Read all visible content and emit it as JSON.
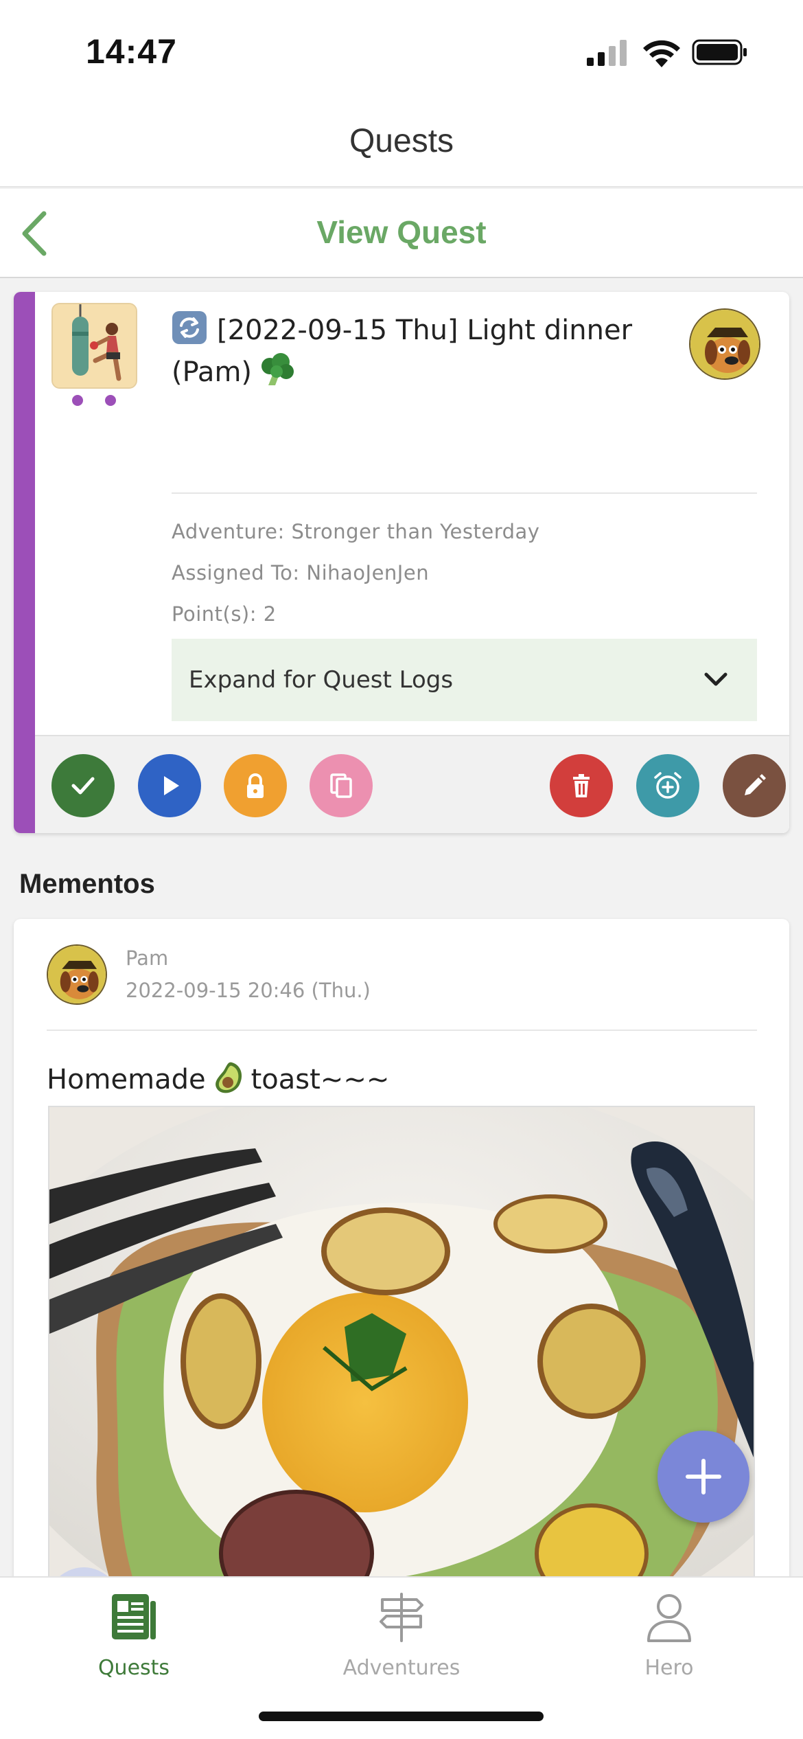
{
  "status_bar": {
    "time": "14:47"
  },
  "header": {
    "title": "Quests"
  },
  "sub_header": {
    "title": "View Quest"
  },
  "quest": {
    "title": "[2022-09-15 Thu] Light dinner (Pam)",
    "adventure": "Adventure: Stronger than Yesterday",
    "assigned_to": "Assigned To: NihaoJenJen",
    "points": "Point(s): 2",
    "expand_label": "Expand for Quest Logs",
    "stripe_color": "#9c4fb8",
    "icons": {
      "repeat": "repeat-icon",
      "broccoli": "broccoli-emoji-icon",
      "thumbnail": "boxing-workout-illustration",
      "avatar": "dog-hat-avatar-icon",
      "chevron": "chevron-down-icon"
    },
    "actions": [
      {
        "name": "complete",
        "icon": "check-icon",
        "color": "#3d7a3a"
      },
      {
        "name": "start",
        "icon": "play-icon",
        "color": "#2f63c5"
      },
      {
        "name": "lock",
        "icon": "lock-icon",
        "color": "#f0a030"
      },
      {
        "name": "duplicate",
        "icon": "copy-icon",
        "color": "#ec90b0"
      },
      {
        "name": "delete",
        "icon": "trash-icon",
        "color": "#d23e3c"
      },
      {
        "name": "reminder",
        "icon": "alarm-add-icon",
        "color": "#3e9aa8"
      },
      {
        "name": "edit",
        "icon": "pencil-icon",
        "color": "#7a5140"
      }
    ]
  },
  "mementos": {
    "heading": "Mementos",
    "items": [
      {
        "author": "Pam",
        "date": "2022-09-15 20:46 (Thu.)",
        "text_before": "Homemade",
        "text_after": "toast~~~",
        "icon": "avocado-emoji-icon",
        "photo": "avocado-toast-egg-photo"
      }
    ]
  },
  "fab": {
    "icon": "plus-icon",
    "color": "#7b87d8"
  },
  "tab_bar": {
    "tabs": [
      {
        "label": "Quests",
        "icon": "quests-document-icon",
        "active": true
      },
      {
        "label": "Adventures",
        "icon": "signpost-icon",
        "active": false
      },
      {
        "label": "Hero",
        "icon": "person-icon",
        "active": false
      }
    ]
  }
}
